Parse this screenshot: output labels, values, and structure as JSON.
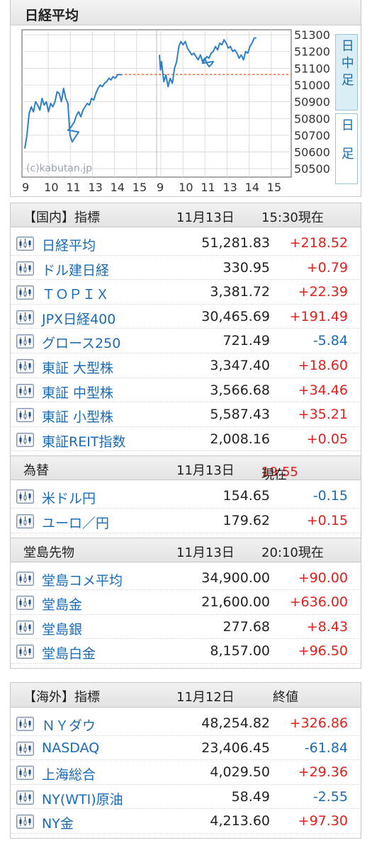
{
  "chart": {
    "title": "日経平均",
    "watermark": "(c)kabutan.jp",
    "tabs": [
      {
        "label": "日中足",
        "active": true
      },
      {
        "label": "日足",
        "active": false
      }
    ]
  },
  "chart_data": {
    "type": "line",
    "title": "日経平均",
    "y_tick_labels": [
      "51300",
      "51200",
      "51100",
      "51000",
      "50900",
      "50800",
      "50700",
      "50600",
      "50500"
    ],
    "x_tick_labels": [
      "9",
      "10",
      "11",
      "13",
      "14",
      "15",
      "9",
      "10",
      "11",
      "13",
      "14",
      "15"
    ],
    "ylim": [
      50450,
      51330
    ],
    "reference_line": {
      "value": 51063,
      "style": "dashed",
      "color": "#e8501c"
    },
    "grid": true,
    "series": [
      {
        "day": 1,
        "x": [
          9.0,
          9.1,
          9.2,
          9.3,
          9.4,
          9.5,
          9.6,
          9.7,
          9.8,
          9.9,
          10.0,
          10.1,
          10.2,
          10.3,
          10.4,
          10.5,
          10.6,
          10.7,
          10.8,
          10.9,
          11.0,
          11.1,
          11.2,
          11.3,
          11.4,
          11.5,
          12.5,
          12.6,
          12.7,
          12.8,
          12.9,
          13.0,
          13.1,
          13.2,
          13.3,
          13.4,
          13.5,
          13.6,
          13.7,
          13.8,
          13.9,
          14.0,
          14.1,
          14.2,
          14.3,
          14.4,
          14.5,
          14.6,
          14.7,
          14.8,
          14.9,
          15.0
        ],
        "y": [
          50620,
          50700,
          50830,
          50870,
          50840,
          50900,
          50880,
          50850,
          50920,
          50880,
          50900,
          50840,
          50890,
          50870,
          50900,
          50960,
          50950,
          50900,
          50980,
          50920,
          50890,
          50700,
          50660,
          50680,
          50700,
          50720,
          50730,
          50740,
          50760,
          50780,
          50820,
          50840,
          50810,
          50850,
          50870,
          50890,
          50880,
          50920,
          50910,
          50950,
          50980,
          51000,
          50990,
          51010,
          51020,
          51040,
          51030,
          51050,
          51040,
          51060,
          51063,
          51060
        ]
      },
      {
        "day": 2,
        "x": [
          9.0,
          9.05,
          9.1,
          9.2,
          9.3,
          9.4,
          9.5,
          9.6,
          9.7,
          9.8,
          9.9,
          10.0,
          10.1,
          10.2,
          10.3,
          10.4,
          10.5,
          10.6,
          10.7,
          10.8,
          10.9,
          11.0,
          11.1,
          11.2,
          11.3,
          11.4,
          11.5,
          12.5,
          12.6,
          12.7,
          12.8,
          12.9,
          13.0,
          13.1,
          13.2,
          13.3,
          13.4,
          13.5,
          13.6,
          13.7,
          13.8,
          13.9,
          14.0,
          14.1,
          14.2,
          14.3,
          14.4,
          14.5,
          14.6,
          14.7,
          14.8,
          14.9,
          15.0
        ],
        "y": [
          51180,
          51090,
          51140,
          51020,
          51060,
          50990,
          51040,
          51010,
          51100,
          51140,
          51230,
          51260,
          51240,
          51260,
          51220,
          51200,
          51180,
          51190,
          51170,
          51150,
          51180,
          51140,
          51160,
          51130,
          51110,
          51120,
          51140,
          51130,
          51150,
          51170,
          51160,
          51190,
          51200,
          51230,
          51210,
          51250,
          51240,
          51270,
          51250,
          51220,
          51230,
          51200,
          51210,
          51190,
          51160,
          51180,
          51150,
          51200,
          51190,
          51230,
          51250,
          51280,
          51282
        ]
      }
    ]
  },
  "domestic": {
    "header": {
      "name": "【国内】指標",
      "date": "11月13日",
      "time": "15:30現在"
    },
    "rows": [
      {
        "name": "日経平均",
        "value": "51,281.83",
        "change": "+218.52",
        "dir": "up"
      },
      {
        "name": "ドル建日経",
        "value": "330.95",
        "change": "+0.79",
        "dir": "up"
      },
      {
        "name": "ＴＯＰＩＸ",
        "value": "3,381.72",
        "change": "+22.39",
        "dir": "up"
      },
      {
        "name": "JPX日経400",
        "value": "30,465.69",
        "change": "+191.49",
        "dir": "up"
      },
      {
        "name": "グロース250",
        "value": "721.49",
        "change": "-5.84",
        "dir": "down"
      },
      {
        "name": "東証 大型株",
        "value": "3,347.40",
        "change": "+18.60",
        "dir": "up"
      },
      {
        "name": "東証 中型株",
        "value": "3,566.68",
        "change": "+34.46",
        "dir": "up"
      },
      {
        "name": "東証 小型株",
        "value": "5,587.43",
        "change": "+35.21",
        "dir": "up"
      },
      {
        "name": "東証REIT指数",
        "value": "2,008.16",
        "change": "+0.05",
        "dir": "up"
      }
    ]
  },
  "fx": {
    "header": {
      "name": "為替",
      "date": "11月13日",
      "time_hl": "19:55",
      "time_suffix": "現在"
    },
    "rows": [
      {
        "name": "米ドル円",
        "value": "154.65",
        "change": "-0.15",
        "dir": "down"
      },
      {
        "name": "ユーロ／円",
        "value": "179.62",
        "change": "+0.15",
        "dir": "up"
      }
    ]
  },
  "dojima": {
    "header": {
      "name": "堂島先物",
      "date": "11月13日",
      "time": "20:10現在"
    },
    "rows": [
      {
        "name": "堂島コメ平均",
        "value": "34,900.00",
        "change": "+90.00",
        "dir": "up"
      },
      {
        "name": "堂島金",
        "value": "21,600.00",
        "change": "+636.00",
        "dir": "up"
      },
      {
        "name": "堂島銀",
        "value": "277.68",
        "change": "+8.43",
        "dir": "up"
      },
      {
        "name": "堂島白金",
        "value": "8,157.00",
        "change": "+96.50",
        "dir": "up"
      }
    ]
  },
  "overseas": {
    "header": {
      "name": "【海外】指標",
      "date": "11月12日",
      "time": "終値"
    },
    "rows": [
      {
        "name": "ＮＹダウ",
        "value": "48,254.82",
        "change": "+326.86",
        "dir": "up"
      },
      {
        "name": "NASDAQ",
        "value": "23,406.45",
        "change": "-61.84",
        "dir": "down"
      },
      {
        "name": "上海総合",
        "value": "4,029.50",
        "change": "+29.36",
        "dir": "up"
      },
      {
        "name": "NY(WTI)原油",
        "value": "58.49",
        "change": "-2.55",
        "dir": "down"
      },
      {
        "name": "NY金",
        "value": "4,213.60",
        "change": "+97.30",
        "dir": "up"
      }
    ]
  }
}
